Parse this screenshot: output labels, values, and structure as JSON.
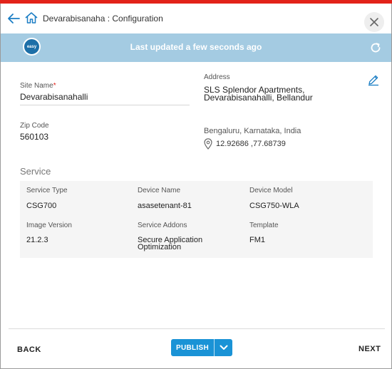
{
  "header": {
    "title": "Devarabisanaha : Configuration"
  },
  "banner": {
    "logo_text": "easy",
    "status_text": "Last updated a few seconds ago"
  },
  "site": {
    "site_name_label": "Site Name",
    "site_name_required_mark": "*",
    "site_name_value": "Devarabisanahalli",
    "zip_label": "Zip Code",
    "zip_value": "560103",
    "address_label": "Address",
    "address_line1": "SLS Splendor Apartments,",
    "address_line2": "Devarabisanahalli, Bellandur",
    "city_line": "Bengaluru, Karnataka, India",
    "coordinates": "12.92686 ,77.68739"
  },
  "service": {
    "section_title": "Service",
    "fields": [
      {
        "label": "Service Type",
        "value": "CSG700"
      },
      {
        "label": "Device Name",
        "value": "asasetenant-81"
      },
      {
        "label": "Device Model",
        "value": "CSG750-WLA"
      },
      {
        "label": "Image Version",
        "value": "21.2.3"
      },
      {
        "label": "Service Addons",
        "value_line1": "Secure Application",
        "value_line2": "Optimization"
      },
      {
        "label": "Template",
        "value": "FM1"
      }
    ]
  },
  "footer": {
    "back_label": "BACK",
    "publish_label": "PUBLISH",
    "next_label": "NEXT"
  },
  "colors": {
    "accent_red": "#e2231a",
    "banner_blue": "#a4cbe2",
    "publish_blue": "#1a93d6"
  },
  "icons": [
    "back-arrow-icon",
    "home-icon",
    "close-icon",
    "easy-logo",
    "refresh-icon",
    "edit-pencil-icon",
    "location-pin-icon",
    "chevron-down-icon"
  ]
}
